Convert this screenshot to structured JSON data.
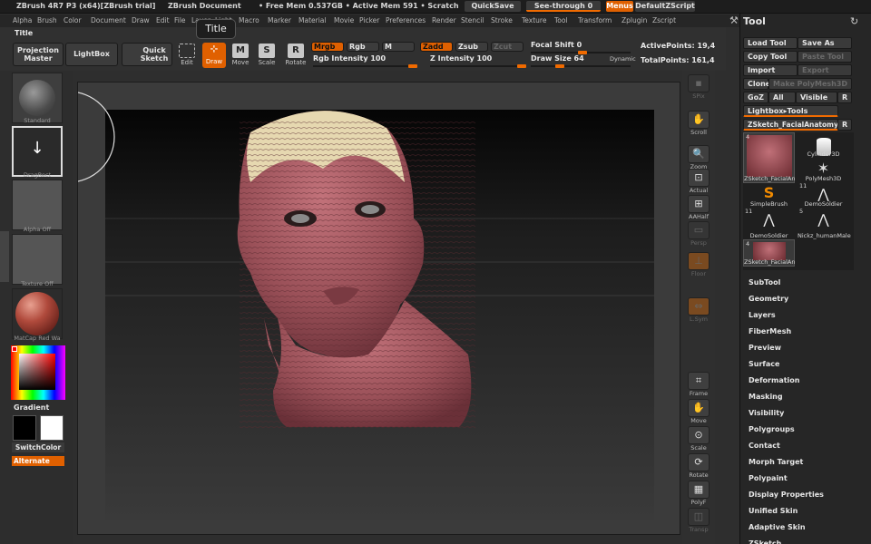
{
  "titlebar": {
    "app": "ZBrush 4R7 P3 (x64)[ZBrush trial]",
    "document": "ZBrush Document",
    "mem": "• Free Mem 0.537GB • Active Mem 591 • Scratch",
    "quicksave": "QuickSave",
    "seethrough": "See-through  0",
    "menus": "Menus",
    "script": "DefaultZScript"
  },
  "menubar": {
    "items": [
      "Alpha",
      "Brush",
      "Color",
      "Document",
      "Draw",
      "Edit",
      "File",
      "Layer",
      "Light",
      "Macro",
      "Marker",
      "Material",
      "Movie",
      "Picker",
      "Preferences",
      "Render",
      "Stencil",
      "Stroke",
      "Texture",
      "Tool",
      "Transform",
      "Zplugin",
      "Zscript"
    ]
  },
  "toolbar": {
    "title_label": "Title",
    "tooltip": "Title",
    "projection_master": "Projection Master",
    "lightbox": "LightBox",
    "quick_sketch": "Quick Sketch",
    "edit": "Edit",
    "draw": "Draw",
    "move": "Move",
    "scale": "Scale",
    "rotate": "Rotate",
    "mrgb": "Mrgb",
    "rgb": "Rgb",
    "m": "M",
    "zadd": "Zadd",
    "zsub": "Zsub",
    "zcut": "Zcut",
    "rgb_intensity": "Rgb Intensity 100",
    "z_intensity": "Z Intensity 100",
    "focal_shift": "Focal Shift 0",
    "draw_size": "Draw Size 64",
    "dynamic": "Dynamic",
    "active_points": "ActivePoints: 19,4",
    "total_points": "TotalPoints: 161,4",
    "accent": "#f06a00"
  },
  "leftshelf": {
    "standard": "Standard",
    "dragrect": "DragRect",
    "alpha_off": "Alpha Off",
    "texture_off": "Texture Off",
    "matcap": "MatCap Red Wa",
    "gradient": "Gradient",
    "switchcolor": "SwitchColor",
    "alternate": "Alternate"
  },
  "rightshelf": {
    "items": [
      "SPix",
      "Scroll",
      "Zoom",
      "Actual",
      "AAHalf",
      "Persp",
      "Floor",
      "L.Sym",
      "Frame",
      "Move",
      "Scale",
      "Rotate",
      "PolyF",
      "Transp"
    ]
  },
  "toolpanel": {
    "title": "Tool",
    "load_tool": "Load Tool",
    "save_as": "Save As",
    "copy_tool": "Copy Tool",
    "paste_tool": "Paste Tool",
    "import": "Import",
    "export": "Export",
    "clone": "Clone",
    "make_polymesh": "Make PolyMesh3D",
    "goz": "GoZ",
    "all": "All",
    "visible": "Visible",
    "r": "R",
    "lightbox_tools": "Lightbox▸Tools",
    "current_tool": "ZSketch_FacialAnatomy",
    "tiles": [
      {
        "name": "ZSketch_FacialAn",
        "count": "4"
      },
      {
        "name": "Cylinder3D",
        "count": ""
      },
      {
        "name": "PolyMesh3D",
        "count": ""
      },
      {
        "name": "SimpleBrush",
        "count": ""
      },
      {
        "name": "DemoSoldier",
        "count": "11"
      },
      {
        "name": "DemoSoldier",
        "count": "11"
      },
      {
        "name": "Nickz_humanMale",
        "count": "5"
      },
      {
        "name": "ZSketch_FacialAn",
        "count": "4"
      }
    ],
    "sections": [
      "SubTool",
      "Geometry",
      "Layers",
      "FiberMesh",
      "Preview",
      "Surface",
      "Deformation",
      "Masking",
      "Visibility",
      "Polygroups",
      "Contact",
      "Morph Target",
      "Polypaint",
      "Display Properties",
      "Unified Skin",
      "Adaptive Skin",
      "ZSketch"
    ]
  }
}
